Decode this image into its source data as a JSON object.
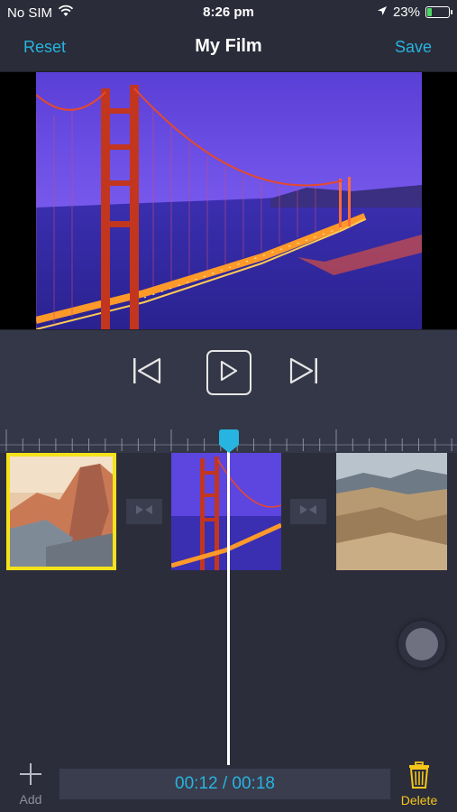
{
  "status": {
    "carrier": "No SIM",
    "time": "8:26 pm",
    "battery": "23%",
    "battery_level": 0.23
  },
  "nav": {
    "reset_label": "Reset",
    "title": "My Film",
    "save_label": "Save"
  },
  "playback": {
    "current_time": "00:12",
    "separator": "/",
    "total_time": "00:18",
    "display": "00:12 / 00:18"
  },
  "clips": [
    {
      "name": "half-dome-sunset",
      "selected": true
    },
    {
      "name": "golden-gate-bridge-night",
      "selected": false
    },
    {
      "name": "desert-badlands",
      "selected": false
    }
  ],
  "toolbar": {
    "add_label": "Add",
    "delete_label": "Delete"
  },
  "colors": {
    "accent": "#27b4e0",
    "selection": "#f5e21a",
    "delete": "#f5c518",
    "background": "#2b2d3a",
    "battery": "#4cd964"
  },
  "icons": {
    "previous": "skip-previous-icon",
    "play": "play-icon",
    "next": "skip-next-icon",
    "add": "plus-icon",
    "delete": "trash-icon",
    "transition": "transition-icon"
  }
}
